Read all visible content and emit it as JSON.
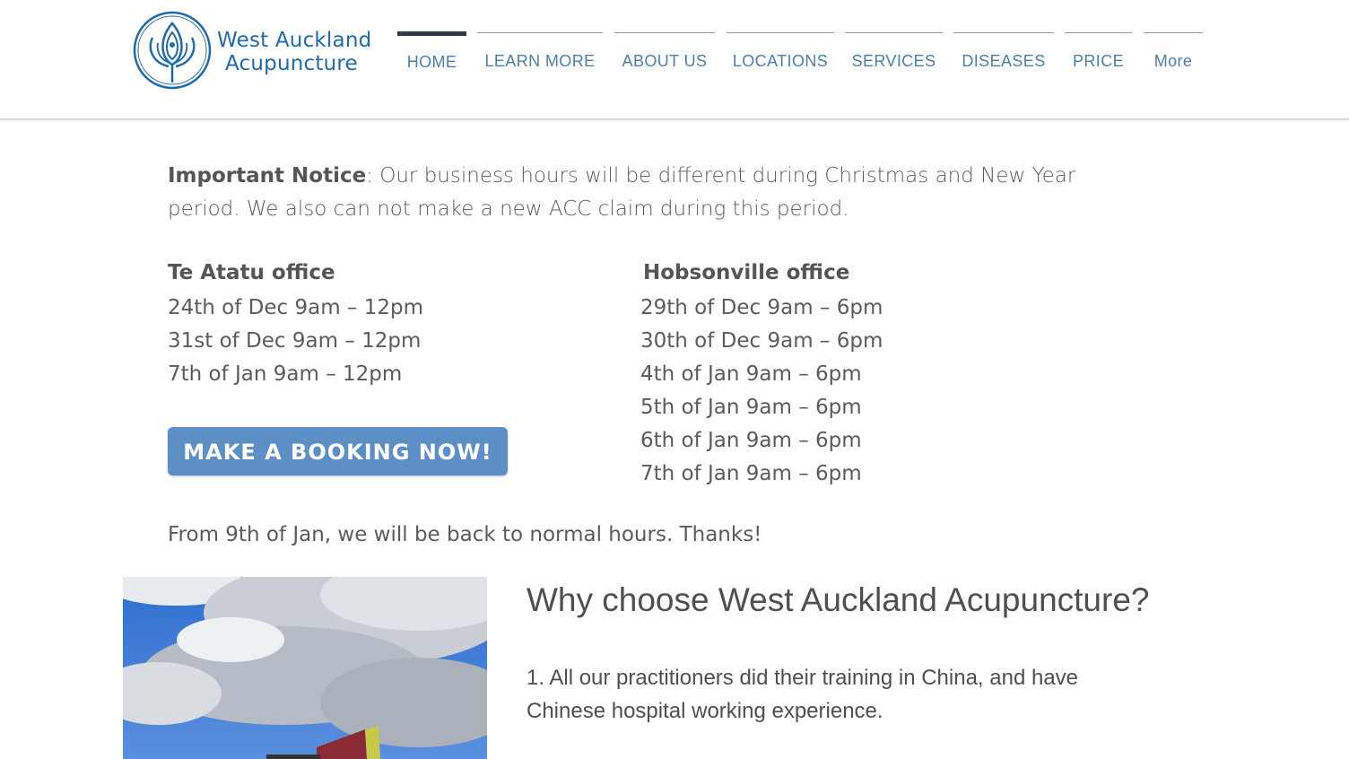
{
  "brand": {
    "line1": "West Auckland",
    "line2": "Acupuncture",
    "color": "#1f6aa7",
    "logo_icon": "lotus-logo-icon"
  },
  "nav": {
    "items": [
      {
        "label": "HOME",
        "active": true
      },
      {
        "label": "LEARN MORE"
      },
      {
        "label": "ABOUT US"
      },
      {
        "label": "LOCATIONS"
      },
      {
        "label": "SERVICES"
      },
      {
        "label": "DISEASES"
      },
      {
        "label": "PRICE"
      },
      {
        "label": "More"
      }
    ],
    "text_color": "#4d7fa6",
    "active_bar_color": "#2e3a48"
  },
  "notice": {
    "heading": "Important Notice",
    "text": ": Our business hours will be different during Christmas and New Year period. We also can not make a new ACC claim during this period."
  },
  "offices": {
    "te_atatu": {
      "title": "Te Atatu office",
      "hours": [
        "24th of Dec 9am – 12pm",
        "31st of Dec 9am – 12pm",
        "7th of Jan 9am – 12pm"
      ]
    },
    "hobsonville": {
      "title": "Hobsonville office",
      "hours": [
        "29th of Dec 9am – 6pm",
        "30th of Dec 9am – 6pm",
        "4th of Jan 9am – 6pm",
        "5th of Jan 9am – 6pm",
        "6th of Jan 9am – 6pm",
        "7th of Jan 9am – 6pm"
      ]
    }
  },
  "booking_button": {
    "label": "MAKE A BOOKING NOW!",
    "color": "#5c8fc6"
  },
  "footer_note": "From 9th of Jan, we will be back to normal hours. Thanks!",
  "why": {
    "title": "Why choose West Auckland Acupuncture?",
    "point1": "1. All our practitioners did their training in China, and have Chinese hospital working experience."
  }
}
